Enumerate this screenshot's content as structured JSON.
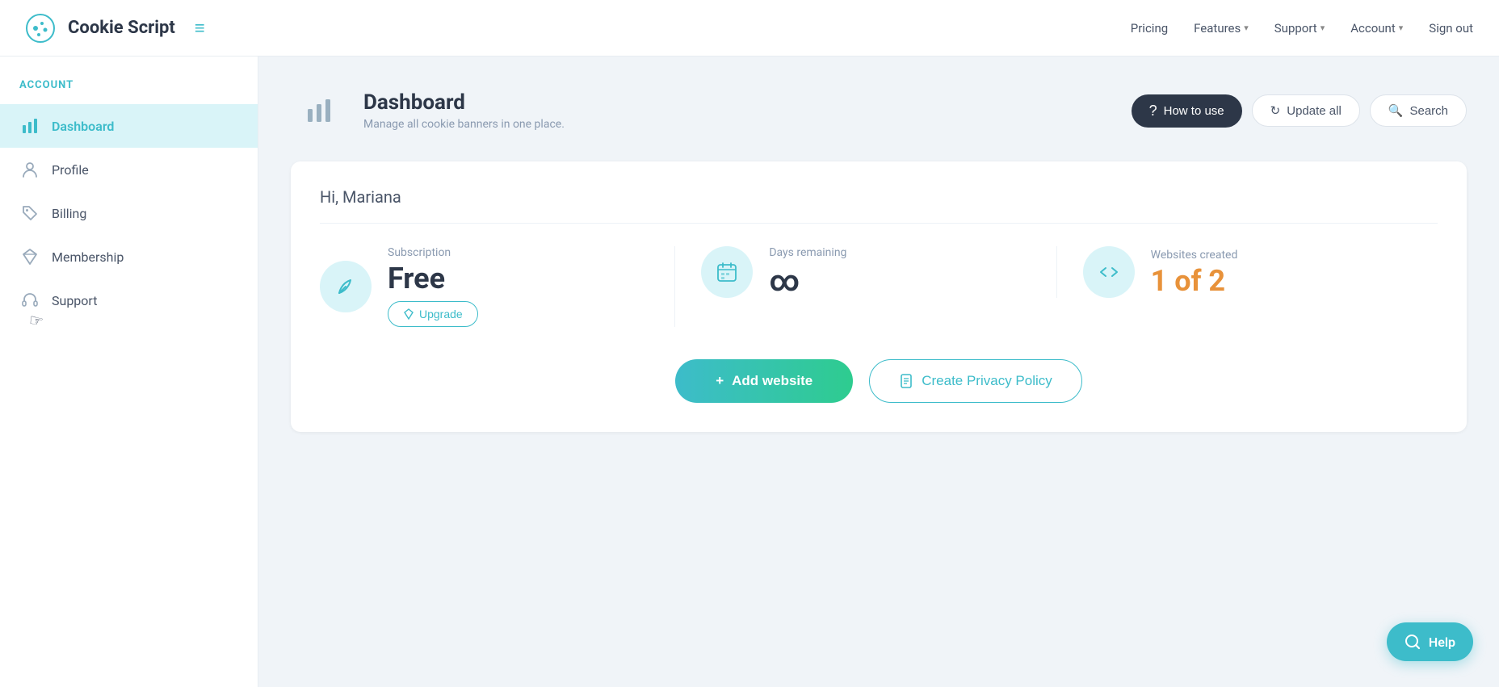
{
  "brand": {
    "name": "Cookie Script",
    "tagline": "Manage all cookie banners in one place."
  },
  "nav": {
    "links": [
      {
        "label": "Pricing",
        "has_dropdown": false
      },
      {
        "label": "Features",
        "has_dropdown": true
      },
      {
        "label": "Support",
        "has_dropdown": true
      },
      {
        "label": "Account",
        "has_dropdown": true
      },
      {
        "label": "Sign out",
        "has_dropdown": false
      }
    ]
  },
  "sidebar": {
    "section_label": "ACCOUNT",
    "items": [
      {
        "label": "Dashboard",
        "active": true,
        "icon": "chart-bar"
      },
      {
        "label": "Profile",
        "active": false,
        "icon": "user"
      },
      {
        "label": "Billing",
        "active": false,
        "icon": "tag"
      },
      {
        "label": "Membership",
        "active": false,
        "icon": "diamond"
      },
      {
        "label": "Support",
        "active": false,
        "icon": "headset"
      }
    ]
  },
  "page": {
    "title": "Dashboard",
    "subtitle": "Manage all cookie banners in one place.",
    "how_to_use_label": "How to use",
    "update_all_label": "Update all",
    "search_label": "Search"
  },
  "dashboard": {
    "greeting": "Hi, Mariana",
    "subscription": {
      "label": "Subscription",
      "value": "Free",
      "upgrade_label": "Upgrade"
    },
    "days_remaining": {
      "label": "Days remaining",
      "value": "∞"
    },
    "websites_created": {
      "label": "Websites created",
      "value": "1 of 2"
    },
    "add_website_label": "+ Add website",
    "create_policy_label": "Create Privacy Policy"
  },
  "help": {
    "label": "Help"
  }
}
